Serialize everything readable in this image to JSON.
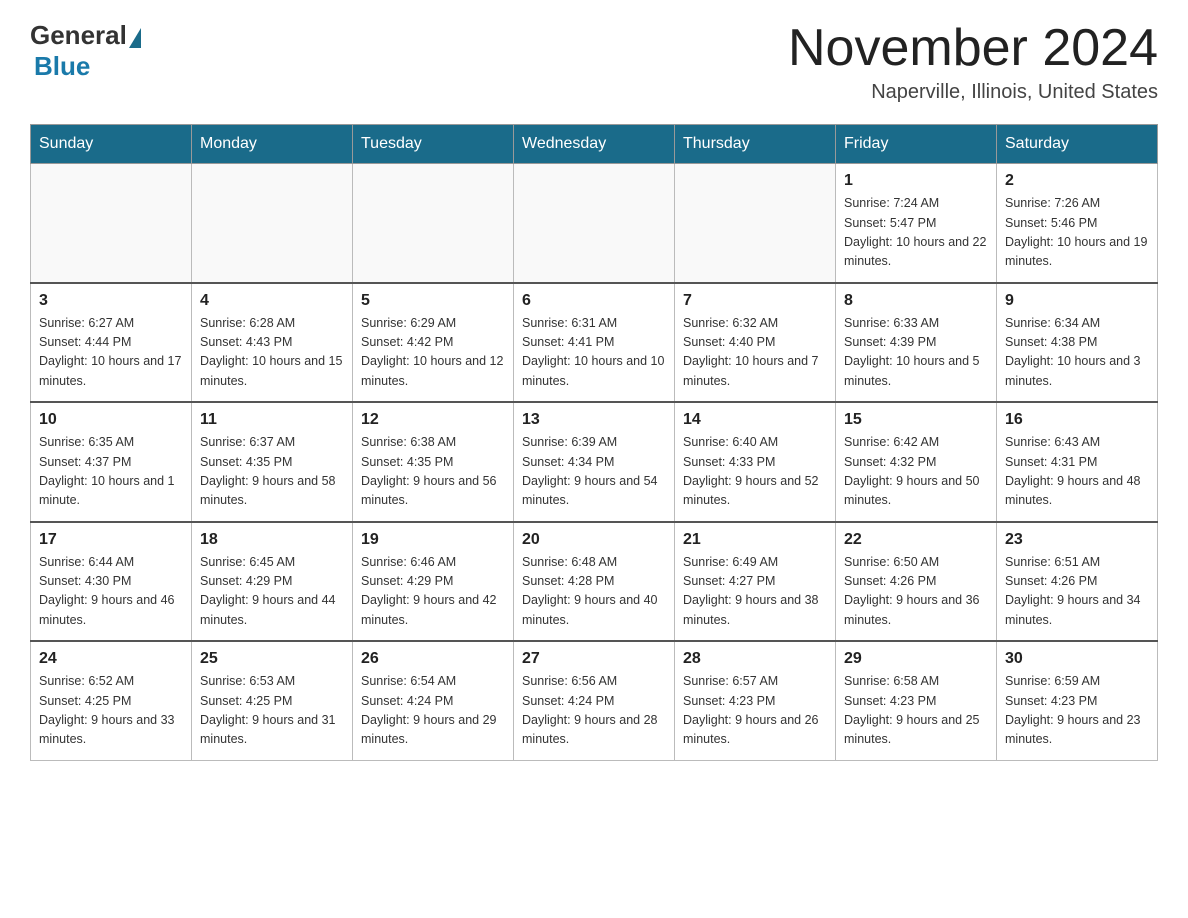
{
  "header": {
    "logo_general": "General",
    "logo_blue": "Blue",
    "month_title": "November 2024",
    "location": "Naperville, Illinois, United States"
  },
  "days_of_week": [
    "Sunday",
    "Monday",
    "Tuesday",
    "Wednesday",
    "Thursday",
    "Friday",
    "Saturday"
  ],
  "weeks": [
    [
      {
        "day": "",
        "info": ""
      },
      {
        "day": "",
        "info": ""
      },
      {
        "day": "",
        "info": ""
      },
      {
        "day": "",
        "info": ""
      },
      {
        "day": "",
        "info": ""
      },
      {
        "day": "1",
        "info": "Sunrise: 7:24 AM\nSunset: 5:47 PM\nDaylight: 10 hours and 22 minutes."
      },
      {
        "day": "2",
        "info": "Sunrise: 7:26 AM\nSunset: 5:46 PM\nDaylight: 10 hours and 19 minutes."
      }
    ],
    [
      {
        "day": "3",
        "info": "Sunrise: 6:27 AM\nSunset: 4:44 PM\nDaylight: 10 hours and 17 minutes."
      },
      {
        "day": "4",
        "info": "Sunrise: 6:28 AM\nSunset: 4:43 PM\nDaylight: 10 hours and 15 minutes."
      },
      {
        "day": "5",
        "info": "Sunrise: 6:29 AM\nSunset: 4:42 PM\nDaylight: 10 hours and 12 minutes."
      },
      {
        "day": "6",
        "info": "Sunrise: 6:31 AM\nSunset: 4:41 PM\nDaylight: 10 hours and 10 minutes."
      },
      {
        "day": "7",
        "info": "Sunrise: 6:32 AM\nSunset: 4:40 PM\nDaylight: 10 hours and 7 minutes."
      },
      {
        "day": "8",
        "info": "Sunrise: 6:33 AM\nSunset: 4:39 PM\nDaylight: 10 hours and 5 minutes."
      },
      {
        "day": "9",
        "info": "Sunrise: 6:34 AM\nSunset: 4:38 PM\nDaylight: 10 hours and 3 minutes."
      }
    ],
    [
      {
        "day": "10",
        "info": "Sunrise: 6:35 AM\nSunset: 4:37 PM\nDaylight: 10 hours and 1 minute."
      },
      {
        "day": "11",
        "info": "Sunrise: 6:37 AM\nSunset: 4:35 PM\nDaylight: 9 hours and 58 minutes."
      },
      {
        "day": "12",
        "info": "Sunrise: 6:38 AM\nSunset: 4:35 PM\nDaylight: 9 hours and 56 minutes."
      },
      {
        "day": "13",
        "info": "Sunrise: 6:39 AM\nSunset: 4:34 PM\nDaylight: 9 hours and 54 minutes."
      },
      {
        "day": "14",
        "info": "Sunrise: 6:40 AM\nSunset: 4:33 PM\nDaylight: 9 hours and 52 minutes."
      },
      {
        "day": "15",
        "info": "Sunrise: 6:42 AM\nSunset: 4:32 PM\nDaylight: 9 hours and 50 minutes."
      },
      {
        "day": "16",
        "info": "Sunrise: 6:43 AM\nSunset: 4:31 PM\nDaylight: 9 hours and 48 minutes."
      }
    ],
    [
      {
        "day": "17",
        "info": "Sunrise: 6:44 AM\nSunset: 4:30 PM\nDaylight: 9 hours and 46 minutes."
      },
      {
        "day": "18",
        "info": "Sunrise: 6:45 AM\nSunset: 4:29 PM\nDaylight: 9 hours and 44 minutes."
      },
      {
        "day": "19",
        "info": "Sunrise: 6:46 AM\nSunset: 4:29 PM\nDaylight: 9 hours and 42 minutes."
      },
      {
        "day": "20",
        "info": "Sunrise: 6:48 AM\nSunset: 4:28 PM\nDaylight: 9 hours and 40 minutes."
      },
      {
        "day": "21",
        "info": "Sunrise: 6:49 AM\nSunset: 4:27 PM\nDaylight: 9 hours and 38 minutes."
      },
      {
        "day": "22",
        "info": "Sunrise: 6:50 AM\nSunset: 4:26 PM\nDaylight: 9 hours and 36 minutes."
      },
      {
        "day": "23",
        "info": "Sunrise: 6:51 AM\nSunset: 4:26 PM\nDaylight: 9 hours and 34 minutes."
      }
    ],
    [
      {
        "day": "24",
        "info": "Sunrise: 6:52 AM\nSunset: 4:25 PM\nDaylight: 9 hours and 33 minutes."
      },
      {
        "day": "25",
        "info": "Sunrise: 6:53 AM\nSunset: 4:25 PM\nDaylight: 9 hours and 31 minutes."
      },
      {
        "day": "26",
        "info": "Sunrise: 6:54 AM\nSunset: 4:24 PM\nDaylight: 9 hours and 29 minutes."
      },
      {
        "day": "27",
        "info": "Sunrise: 6:56 AM\nSunset: 4:24 PM\nDaylight: 9 hours and 28 minutes."
      },
      {
        "day": "28",
        "info": "Sunrise: 6:57 AM\nSunset: 4:23 PM\nDaylight: 9 hours and 26 minutes."
      },
      {
        "day": "29",
        "info": "Sunrise: 6:58 AM\nSunset: 4:23 PM\nDaylight: 9 hours and 25 minutes."
      },
      {
        "day": "30",
        "info": "Sunrise: 6:59 AM\nSunset: 4:23 PM\nDaylight: 9 hours and 23 minutes."
      }
    ]
  ]
}
